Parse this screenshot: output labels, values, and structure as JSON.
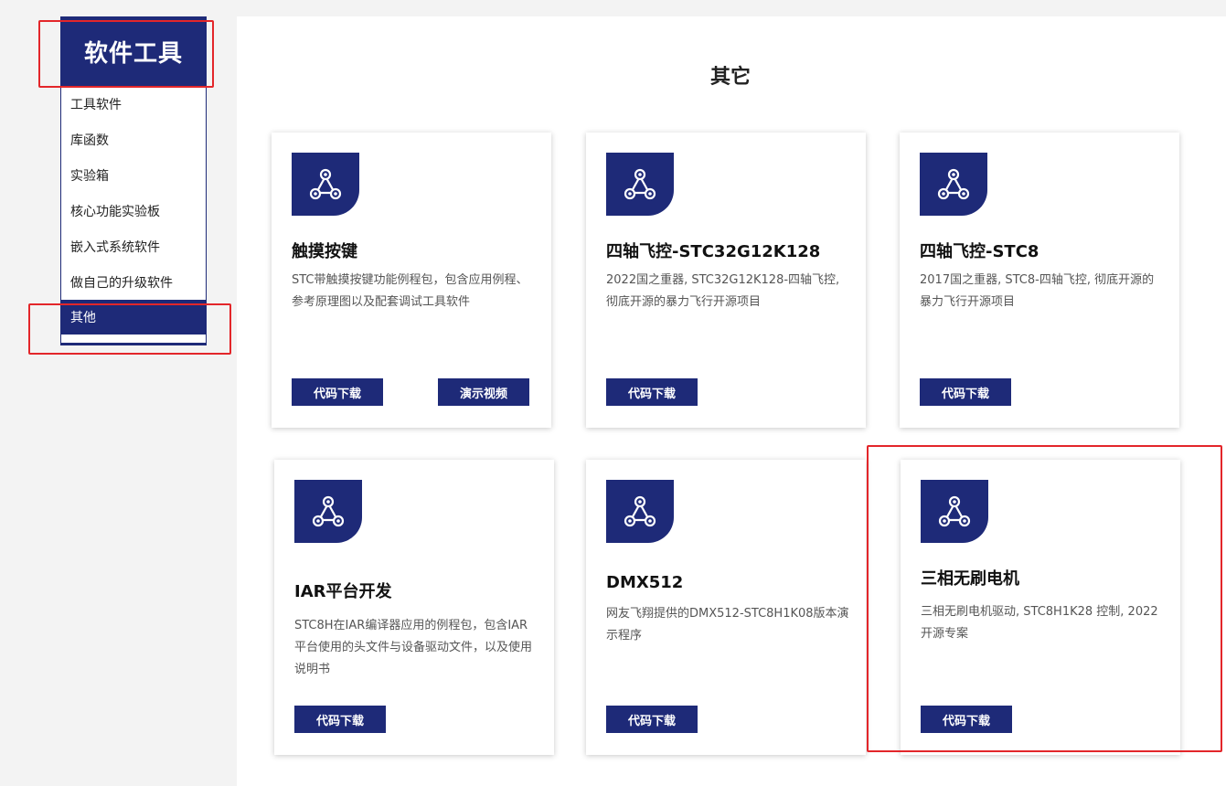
{
  "sidebar": {
    "title": "软件工具",
    "items": [
      {
        "label": "工具软件"
      },
      {
        "label": "库函数"
      },
      {
        "label": "实验箱"
      },
      {
        "label": "核心功能实验板"
      },
      {
        "label": "嵌入式系统软件"
      },
      {
        "label": "做自己的升级软件"
      },
      {
        "label": "其他"
      }
    ],
    "active_item": "其他"
  },
  "main": {
    "title": "其它",
    "cards": [
      {
        "icon": "network-icon",
        "title": "触摸按键",
        "desc": "STC带触摸按键功能例程包，包含应用例程、参考原理图以及配套调试工具软件",
        "buttons": [
          {
            "label": "代码下载"
          },
          {
            "label": "演示视频"
          }
        ]
      },
      {
        "icon": "network-icon",
        "title": "四轴飞控-STC32G12K128",
        "desc": "2022国之重器, STC32G12K128-四轴飞控, 彻底开源的暴力飞行开源项目",
        "buttons": [
          {
            "label": "代码下载"
          }
        ]
      },
      {
        "icon": "network-icon",
        "title": "四轴飞控-STC8",
        "desc": "2017国之重器, STC8-四轴飞控, 彻底开源的暴力飞行开源项目",
        "buttons": [
          {
            "label": "代码下载"
          }
        ]
      },
      {
        "icon": "network-icon",
        "title": "IAR平台开发",
        "desc": "STC8H在IAR编译器应用的例程包，包含IAR平台使用的头文件与设备驱动文件，以及使用说明书",
        "buttons": [
          {
            "label": "代码下载"
          }
        ]
      },
      {
        "icon": "network-icon",
        "title": "DMX512",
        "desc": "网友飞翔提供的DMX512-STC8H1K08版本演示程序",
        "buttons": [
          {
            "label": "代码下载"
          }
        ]
      },
      {
        "icon": "network-icon",
        "title": "三相无刷电机",
        "desc": "三相无刷电机驱动, STC8H1K28 控制, 2022开源专案",
        "buttons": [
          {
            "label": "代码下载"
          }
        ]
      }
    ]
  },
  "colors": {
    "brand": "#1e2a78",
    "highlight": "#e3262a",
    "background": "#f3f3f3"
  }
}
